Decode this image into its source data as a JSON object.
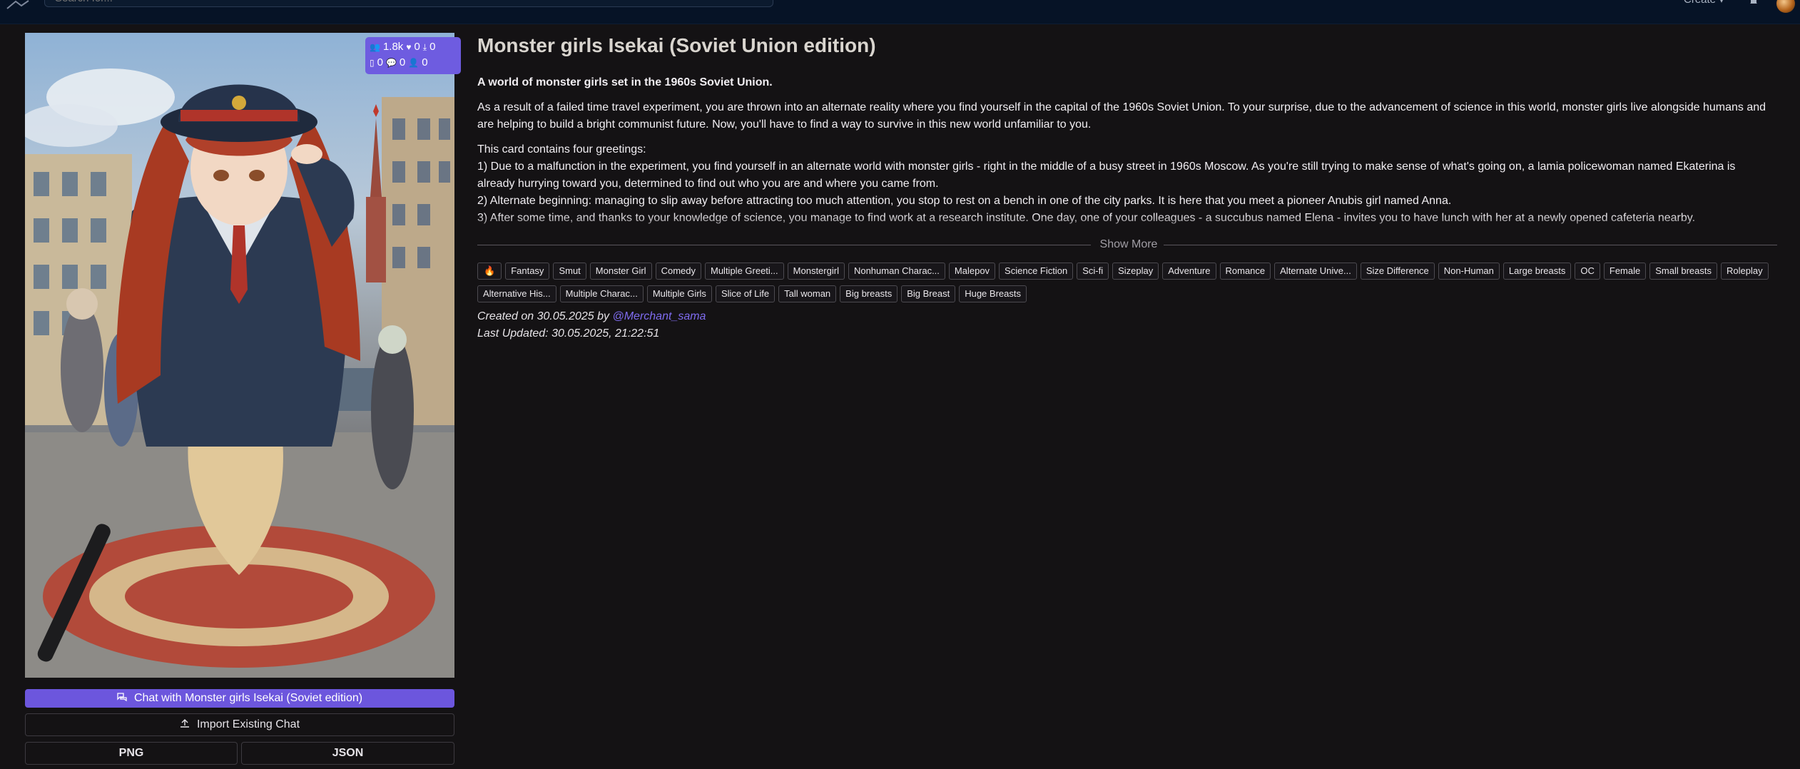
{
  "topbar": {
    "search_placeholder": "Search for...",
    "create_label": "Create ▾",
    "bell_icon": "bell-icon"
  },
  "card": {
    "title": "Monster girls Isekai (Soviet Union edition)",
    "stats": {
      "views": "1.8k",
      "likes": "0",
      "downloads": "0",
      "tokens": "0",
      "chats": "0",
      "users": "0"
    },
    "tagline": "A world of monster girls set in the 1960s Soviet Union.",
    "paragraphs": [
      "As a result of a failed time travel experiment, you are thrown into an alternate reality where you find yourself in the capital of the 1960s Soviet Union. To your surprise, due to the advancement of science in this world, monster girls live alongside humans and are helping to build a bright communist future. Now, you'll have to find a way to survive in this new world unfamiliar to you.",
      "This card contains four greetings:",
      "1) Due to a malfunction in the experiment, you find yourself in an alternate world with monster girls - right in the middle of a busy street in 1960s Moscow. As you're still trying to make sense of what's going on, a lamia policewoman named Ekaterina is already hurrying toward you, determined to find out who you are and where you came from.",
      "2) Alternate beginning: managing to slip away before attracting too much attention, you stop to rest on a bench in one of the city parks. It is here that you meet a pioneer Anubis girl named Anna.",
      "3) After some time, and thanks to your knowledge of science, you manage to find work at a research institute. One day, one of your colleagues - a succubus named Elena - invites you to have lunch with her at a newly opened cafeteria nearby."
    ],
    "show_more": "Show More",
    "tags": [
      "🔥",
      "Fantasy",
      "Smut",
      "Monster Girl",
      "Comedy",
      "Multiple Greeti...",
      "Monstergirl",
      "Nonhuman Charac...",
      "Malepov",
      "Science Fiction",
      "Sci-fi",
      "Sizeplay",
      "Adventure",
      "Romance",
      "Alternate Unive...",
      "Size Difference",
      "Non-Human",
      "Large breasts",
      "OC",
      "Female",
      "Small breasts",
      "Roleplay",
      "Alternative His...",
      "Multiple Charac...",
      "Multiple Girls",
      "Slice of Life",
      "Tall woman",
      "Big breasts",
      "Big Breast",
      "Huge Breasts"
    ],
    "created_prefix": "Created on 30.05.2025 by ",
    "author": "@Merchant_sama",
    "updated": "Last Updated: 30.05.2025, 21:22:51"
  },
  "actions": {
    "chat_label": "Chat with Monster girls Isekai (Soviet edition)",
    "import_label": "Import Existing Chat",
    "png_label": "PNG",
    "json_label": "JSON"
  },
  "colors": {
    "accent": "#6c56dd",
    "badge": "#6e5ce0",
    "link": "#7f6cf0",
    "background": "#141214",
    "topbar": "#061326"
  }
}
